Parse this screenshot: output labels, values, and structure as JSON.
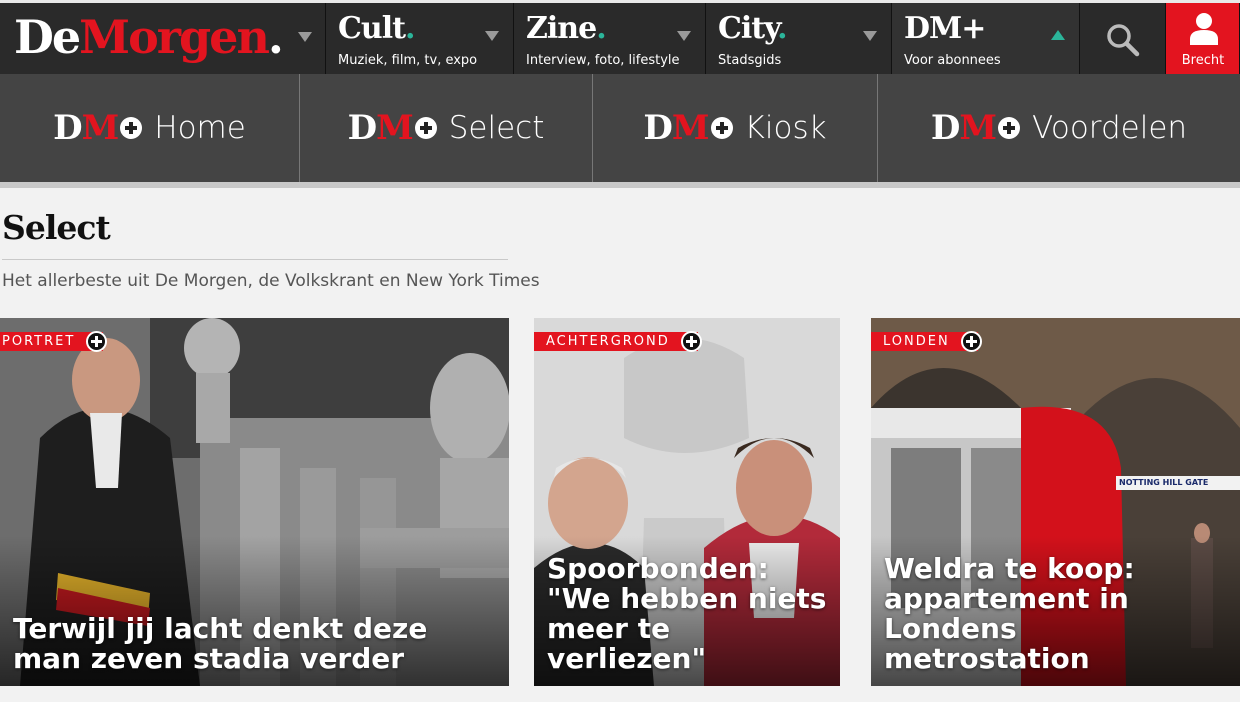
{
  "header": {
    "logo": {
      "part1": "De",
      "part2": "Morgen",
      "part3": "."
    },
    "sections": [
      {
        "title": "Cult",
        "dot": ".",
        "subtitle": "Muziek, film, tv, expo"
      },
      {
        "title": "Zine",
        "dot": ".",
        "subtitle": "Interview, foto, lifestyle"
      },
      {
        "title": "City",
        "dot": ".",
        "subtitle": "Stadsgids"
      }
    ],
    "dm_plus": {
      "title": "DM+",
      "subtitle": "Voor abonnees"
    },
    "user": {
      "name": "Brecht"
    },
    "colors": {
      "brand_red": "#e3141f",
      "accent_green": "#2bb59a"
    }
  },
  "dm_nav": {
    "mark_d": "D",
    "mark_m": "M",
    "items": [
      {
        "label": "Home"
      },
      {
        "label": "Select"
      },
      {
        "label": "Kiosk"
      },
      {
        "label": "Voordelen"
      }
    ]
  },
  "page": {
    "title": "Select",
    "subtitle": "Het allerbeste uit De Morgen, de Volkskrant en New York Times"
  },
  "cards": [
    {
      "tag": "PORTRET",
      "headline": "Terwijl jij lacht denkt deze man zeven stadia verder"
    },
    {
      "tag": "ACHTERGROND",
      "headline": "Spoorbonden: \"We hebben niets meer te verliezen\""
    },
    {
      "tag": "LONDEN",
      "headline": "Weldra te koop: appartement in Londens metrostation",
      "image_sign": "NOTTING HILL GATE"
    }
  ]
}
